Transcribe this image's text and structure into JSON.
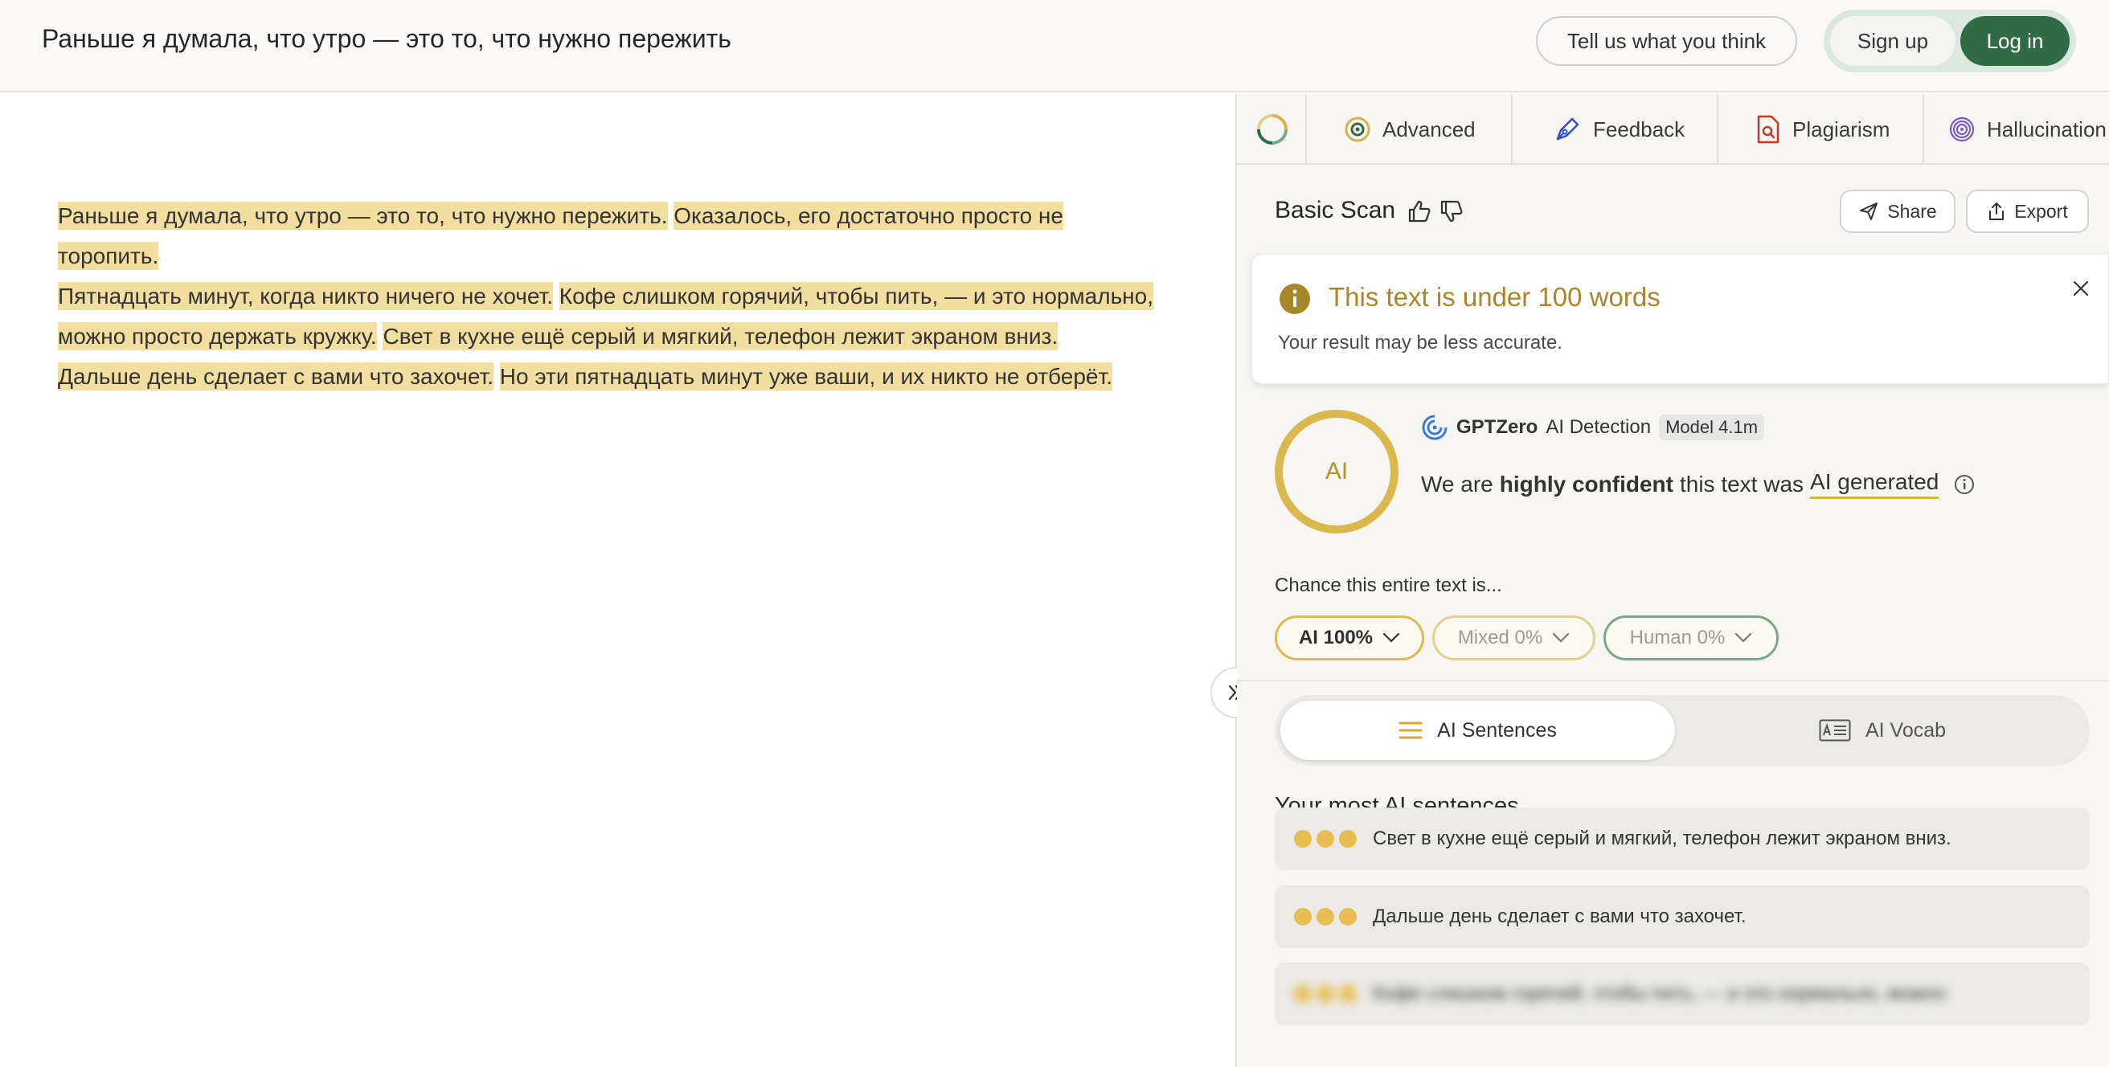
{
  "header": {
    "title": "Раньше я думала, что утро — это то, что нужно пережить",
    "feedback_label": "Tell us what you think",
    "signup_label": "Sign up",
    "login_label": "Log in"
  },
  "editor": {
    "paragraphs": [
      [
        "Раньше я думала, что утро — это то, что нужно пережить.",
        "Оказалось, его достаточно просто не торопить."
      ],
      [
        "Пятнадцать минут, когда никто ничего не хочет.",
        "Кофе слишком горячий, чтобы пить, — и это нормально, можно просто держать кружку.",
        "Свет в кухне ещё серый и мягкий, телефон лежит экраном вниз."
      ],
      [
        "Дальше день сделает с вами что захочет.",
        "Но эти пятнадцать минут уже ваши, и их никто не отберёт."
      ]
    ]
  },
  "panel": {
    "tabs": [
      {
        "label": "Advanced",
        "icon": "advanced-icon"
      },
      {
        "label": "Feedback",
        "icon": "pen-icon"
      },
      {
        "label": "Plagiarism",
        "icon": "document-search-icon"
      },
      {
        "label": "Hallucination",
        "icon": "fingerprint-icon"
      }
    ],
    "scan_title": "Basic Scan",
    "share_label": "Share",
    "export_label": "Export",
    "notice": {
      "title": "This text is under 100 words",
      "subtitle": "Your result may be less accurate."
    },
    "result": {
      "ring_label": "AI",
      "brand": "GPTZero",
      "detection_label": "AI Detection",
      "model": "Model 4.1m",
      "verdict_prefix": "We are",
      "verdict_confidence": "highly confident",
      "verdict_middle": "this text was",
      "verdict_result": "AI generated"
    },
    "chance_label": "Chance this entire text is...",
    "chips": {
      "ai": "AI 100%",
      "mixed": "Mixed 0%",
      "human": "Human 0%"
    },
    "segments": {
      "sentences": "AI Sentences",
      "vocab": "AI Vocab"
    },
    "most_title": "Your most AI sentences",
    "sentences": [
      "Свет в кухне ещё серый и мягкий, телефон лежит экраном вниз.",
      "Дальше день сделает с вами что захочет.",
      "Кофе слишком горячий, чтобы пить, — и это нормально, можно"
    ]
  },
  "colors": {
    "accent_gold": "#dbb84e",
    "highlight": "#f2dfa0",
    "brand_green": "#2f6b45",
    "human_green": "#7aa58e"
  }
}
